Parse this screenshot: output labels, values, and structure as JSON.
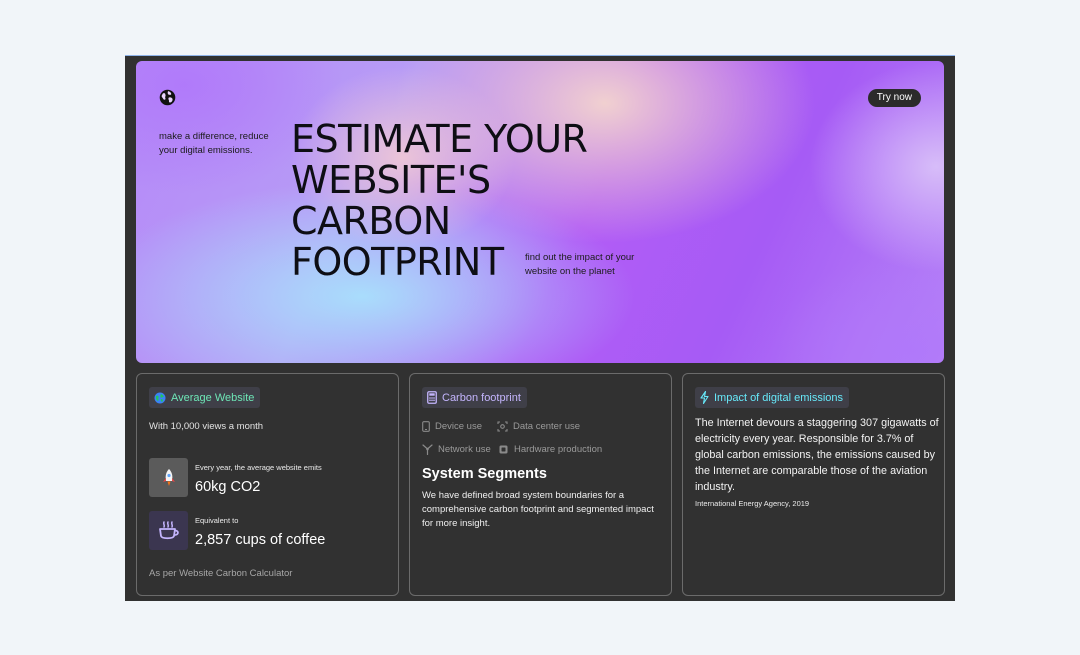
{
  "hero": {
    "cta_label": "Try now",
    "tagline": "make a difference, reduce your digital emissions.",
    "headline_lines": [
      "ESTIMATE YOUR",
      "WEBSITE'S",
      "CARBON",
      "FOOTPRINT"
    ],
    "subline": "find out the impact of your website on the planet",
    "icon": "globe-icon"
  },
  "card_average": {
    "pill_label": "Average Website",
    "pill_icon": "earth-globe-icon",
    "subtitle": "With 10,000 views a month",
    "stats": [
      {
        "caption": "Every year, the average website emits",
        "value": "60kg CO2",
        "icon": "rocket-icon"
      },
      {
        "caption": "Equivalent to",
        "value": "2,857 cups of coffee",
        "icon": "coffee-cup-icon"
      }
    ],
    "source": "As per Website Carbon Calculator"
  },
  "card_footprint": {
    "pill_label": "Carbon footprint",
    "pill_icon": "calculator-icon",
    "segments": [
      {
        "label": "Device use",
        "icon": "device-icon"
      },
      {
        "label": "Data center use",
        "icon": "data-center-icon"
      },
      {
        "label": "Network use",
        "icon": "network-icon"
      },
      {
        "label": "Hardware production",
        "icon": "chip-icon"
      }
    ],
    "title": "System Segments",
    "body": "We have defined broad system boundaries for a comprehensive carbon footprint and segmented impact for more insight."
  },
  "card_impact": {
    "pill_label": "Impact of digital emissions",
    "pill_icon": "lightning-icon",
    "body": "The Internet devours a staggering 307 gigawatts of electricity every year. Responsible for 3.7% of global carbon emissions, the emissions caused by the Internet are comparable those of the aviation industry.",
    "citation": "International Energy Agency, 2019"
  },
  "colors": {
    "frame": "#313131",
    "page": "#f1f5f9",
    "average_accent": "#6ee7b7",
    "footprint_accent": "#c4b5fd",
    "impact_accent": "#67e8f9"
  }
}
